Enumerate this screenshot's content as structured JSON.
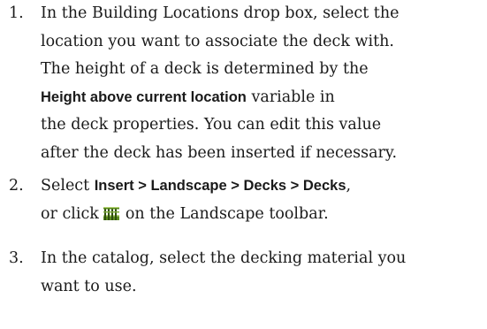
{
  "steps": [
    {
      "number": "1.",
      "lines": [
        "In the Building Locations drop box, select the",
        "location you want to associate the deck with.",
        "The height of a deck is determined by the"
      ],
      "bold_term": "Height above current location",
      "after_bold": " variable in",
      "tail_lines": [
        "the deck properties. You can edit this value",
        "after the deck has been inserted if necessary."
      ]
    },
    {
      "number": "2.",
      "prefix": "Select ",
      "menu_path": "Insert > Landscape > Decks > Decks",
      "suffix": ",",
      "line2_before": "or click",
      "line2_after": "on the Landscape toolbar.",
      "toolbar_icon": "deck-tool-icon"
    },
    {
      "number": "3.",
      "lines": [
        "In the catalog, select the decking material you",
        "want to use."
      ]
    }
  ],
  "colors": {
    "text": "#1a1a1a",
    "icon_green": "#5a8a1e",
    "icon_light": "#b9d77a",
    "icon_dark": "#2f4f0f"
  }
}
